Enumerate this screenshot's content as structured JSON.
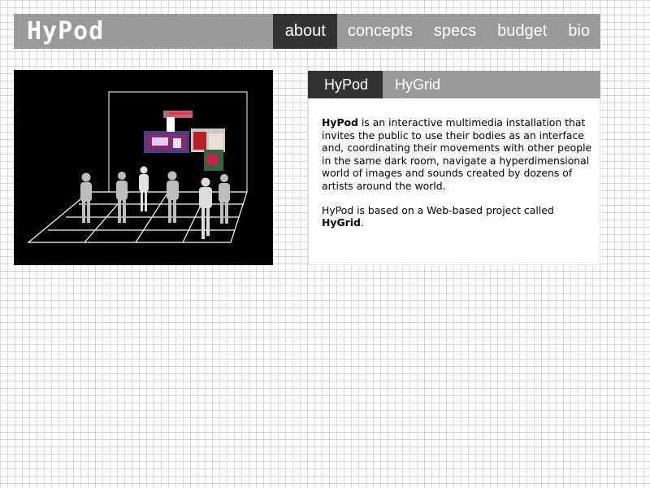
{
  "header": {
    "logo_text": "HyPod",
    "nav": [
      {
        "label": "about",
        "active": true
      },
      {
        "label": "concepts",
        "active": false
      },
      {
        "label": "specs",
        "active": false
      },
      {
        "label": "budget",
        "active": false
      },
      {
        "label": "bio",
        "active": false
      }
    ]
  },
  "tabs": [
    {
      "label": "HyPod",
      "active": true
    },
    {
      "label": "HyGrid",
      "active": false
    }
  ],
  "content": {
    "p1_bold": "HyPod",
    "p1_rest": " is an interactive multimedia installation that invites the public to use their bodies as an interface and, coordinating their movements with other people in the same dark room, navigate a hyperdimensional world of images and sounds created by dozens of artists around the world.",
    "p2_text": "HyPod is based on a Web-based project called ",
    "p2_bold": "HyGrid",
    "p2_end": "."
  },
  "colors": {
    "header_bg": "#999999",
    "active_bg": "#333333",
    "text_on_dark": "#ffffff"
  }
}
